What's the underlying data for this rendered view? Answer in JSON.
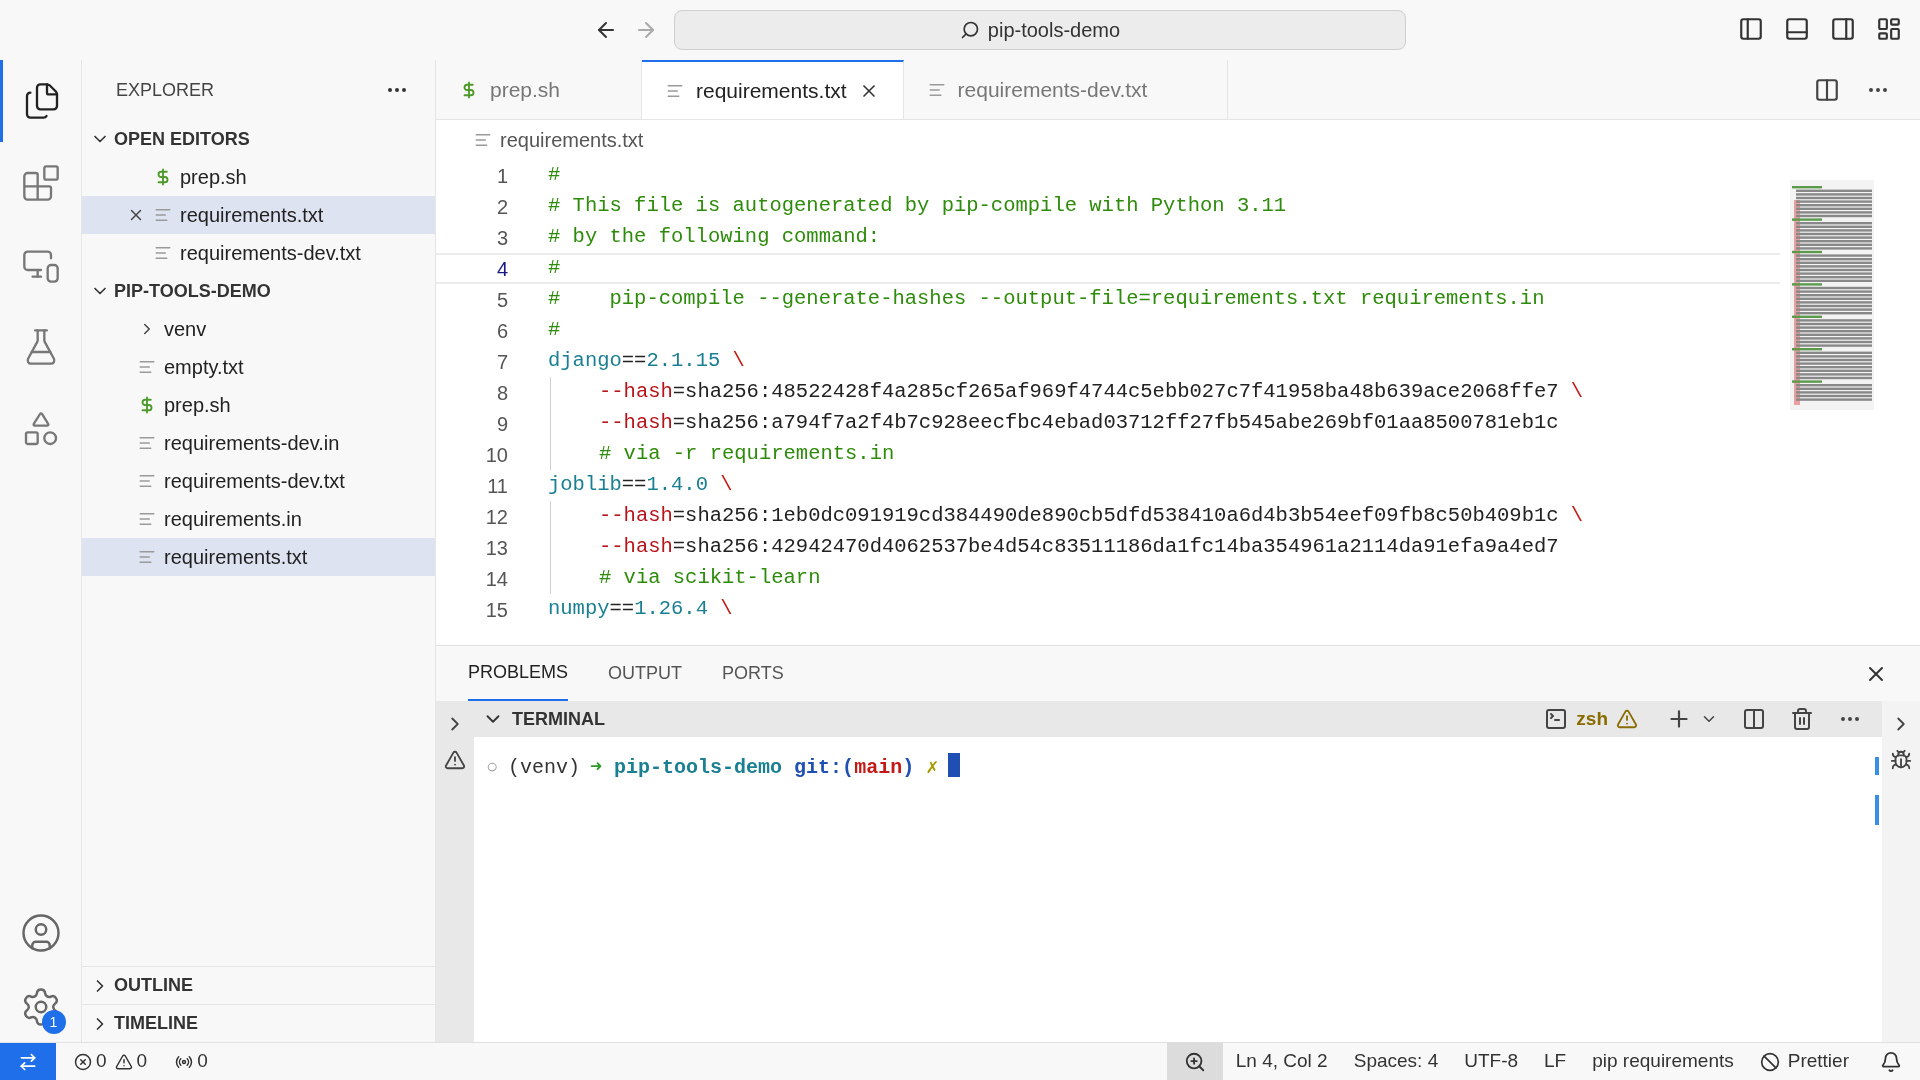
{
  "title_bar": {
    "search": "pip-tools-demo"
  },
  "activity_bar": {
    "items": [
      {
        "kind": "files",
        "selected": true
      },
      {
        "kind": "extensions",
        "selected": false
      },
      {
        "kind": "remote",
        "selected": false
      },
      {
        "kind": "testing",
        "selected": false
      },
      {
        "kind": "shapes",
        "selected": false
      }
    ],
    "settings_badge": "1"
  },
  "sidebar": {
    "title": "EXPLORER",
    "sections": [
      {
        "title": "OPEN EDITORS",
        "expanded": true,
        "items": [
          {
            "name": "prep.sh",
            "kind": "shell",
            "selected": false,
            "close": false
          },
          {
            "name": "requirements.txt",
            "kind": "text",
            "selected": true,
            "close": true
          },
          {
            "name": "requirements-dev.txt",
            "kind": "text",
            "selected": false,
            "close": false
          }
        ]
      },
      {
        "title": "PIP-TOOLS-DEMO",
        "expanded": true,
        "items": [
          {
            "name": "venv",
            "kind": "folder",
            "selected": false,
            "close": false
          },
          {
            "name": "empty.txt",
            "kind": "text",
            "selected": false,
            "close": false
          },
          {
            "name": "prep.sh",
            "kind": "shell",
            "selected": false,
            "close": false
          },
          {
            "name": "requirements-dev.in",
            "kind": "text",
            "selected": false,
            "close": false
          },
          {
            "name": "requirements-dev.txt",
            "kind": "text",
            "selected": false,
            "close": false
          },
          {
            "name": "requirements.in",
            "kind": "text",
            "selected": false,
            "close": false
          },
          {
            "name": "requirements.txt",
            "kind": "text",
            "selected": true,
            "close": false
          }
        ]
      }
    ],
    "bottom_sections": [
      {
        "title": "OUTLINE",
        "expanded": false
      },
      {
        "title": "TIMELINE",
        "expanded": false
      }
    ]
  },
  "tabs": [
    {
      "label": "prep.sh",
      "kind": "shell",
      "selected": false
    },
    {
      "label": "requirements.txt",
      "kind": "text",
      "selected": true
    },
    {
      "label": "requirements-dev.txt",
      "kind": "text",
      "selected": false
    }
  ],
  "breadcrumb": "requirements.txt",
  "editor": {
    "lines": [
      {
        "number": "1",
        "current": false,
        "indented": false,
        "tokens": [
          {
            "kind": "comment",
            "text": "#"
          }
        ]
      },
      {
        "number": "2",
        "current": false,
        "indented": false,
        "tokens": [
          {
            "kind": "comment",
            "text": "# This file is autogenerated by pip-compile with Python 3.11"
          }
        ]
      },
      {
        "number": "3",
        "current": false,
        "indented": false,
        "tokens": [
          {
            "kind": "comment",
            "text": "# by the following command:"
          }
        ]
      },
      {
        "number": "4",
        "current": true,
        "indented": false,
        "tokens": [
          {
            "kind": "comment",
            "text": "#"
          }
        ]
      },
      {
        "number": "5",
        "current": false,
        "indented": false,
        "tokens": [
          {
            "kind": "comment",
            "text": "#    pip-compile --generate-hashes --output-file=requirements.txt requirements.in"
          }
        ]
      },
      {
        "number": "6",
        "current": false,
        "indented": false,
        "tokens": [
          {
            "kind": "comment",
            "text": "#"
          }
        ]
      },
      {
        "number": "7",
        "current": false,
        "indented": false,
        "tokens": [
          {
            "kind": "package",
            "text": "django"
          },
          {
            "kind": "plain",
            "text": "=="
          },
          {
            "kind": "version",
            "text": "2.1.15"
          },
          {
            "kind": "escape",
            "text": " \\"
          }
        ]
      },
      {
        "number": "8",
        "current": false,
        "indented": true,
        "tokens": [
          {
            "kind": "flag",
            "text": "--hash"
          },
          {
            "kind": "plain",
            "text": "=sha256:48522428f4a285cf265af969f4744c5ebb027c7f41958ba48b639ace2068ffe7"
          },
          {
            "kind": "escape",
            "text": " \\"
          }
        ]
      },
      {
        "number": "9",
        "current": false,
        "indented": true,
        "tokens": [
          {
            "kind": "flag",
            "text": "--hash"
          },
          {
            "kind": "plain",
            "text": "=sha256:a794f7a2f4b7c928eecfbc4ebad03712ff27fb545abe269bf01aa8500781eb1c"
          }
        ]
      },
      {
        "number": "10",
        "current": false,
        "indented": true,
        "tokens": [
          {
            "kind": "comment",
            "text": "# via -r requirements.in"
          }
        ]
      },
      {
        "number": "11",
        "current": false,
        "indented": false,
        "tokens": [
          {
            "kind": "package",
            "text": "joblib"
          },
          {
            "kind": "plain",
            "text": "=="
          },
          {
            "kind": "version",
            "text": "1.4.0"
          },
          {
            "kind": "escape",
            "text": " \\"
          }
        ]
      },
      {
        "number": "12",
        "current": false,
        "indented": true,
        "tokens": [
          {
            "kind": "flag",
            "text": "--hash"
          },
          {
            "kind": "plain",
            "text": "=sha256:1eb0dc091919cd384490de890cb5dfd538410a6d4b3b54eef09fb8c50b409b1c"
          },
          {
            "kind": "escape",
            "text": " \\"
          }
        ]
      },
      {
        "number": "13",
        "current": false,
        "indented": true,
        "tokens": [
          {
            "kind": "flag",
            "text": "--hash"
          },
          {
            "kind": "plain",
            "text": "=sha256:42942470d4062537be4d54c83511186da1fc14ba354961a2114da91efa9a4ed7"
          }
        ]
      },
      {
        "number": "14",
        "current": false,
        "indented": true,
        "tokens": [
          {
            "kind": "comment",
            "text": "# via scikit-learn"
          }
        ]
      },
      {
        "number": "15",
        "current": false,
        "indented": false,
        "tokens": [
          {
            "kind": "package",
            "text": "numpy"
          },
          {
            "kind": "plain",
            "text": "=="
          },
          {
            "kind": "version",
            "text": "1.26.4"
          },
          {
            "kind": "escape",
            "text": " \\"
          }
        ]
      }
    ]
  },
  "panel": {
    "tabs": [
      {
        "label": "PROBLEMS",
        "selected": true
      },
      {
        "label": "OUTPUT",
        "selected": false
      },
      {
        "label": "PORTS",
        "selected": false
      }
    ],
    "terminal": {
      "title": "TERMINAL",
      "expanded": true,
      "shell": "zsh",
      "prompt": [
        {
          "kind": "dim",
          "text": "○"
        },
        {
          "kind": "plain",
          "text": "(venv)"
        },
        {
          "kind": "arrow",
          "text": "➜"
        },
        {
          "kind": "dir",
          "text": " pip-tools-demo"
        },
        {
          "kind": "git",
          "text": "git:("
        },
        {
          "kind": "branch",
          "text": "main"
        },
        {
          "kind": "git",
          "text": ")"
        },
        {
          "kind": "dirty",
          "text": "✗"
        }
      ]
    }
  },
  "status_bar": {
    "errors": "0",
    "warnings": "0",
    "ports": "0",
    "items": [
      {
        "kind": "zoom"
      },
      {
        "kind": "text",
        "text": "Ln 4, Col 2"
      },
      {
        "kind": "text",
        "text": "Spaces: 4"
      },
      {
        "kind": "text",
        "text": "UTF-8"
      },
      {
        "kind": "text",
        "text": "LF"
      },
      {
        "kind": "text",
        "text": "pip requirements"
      },
      {
        "kind": "prettier",
        "text": "Prettier"
      },
      {
        "kind": "bell"
      }
    ]
  }
}
